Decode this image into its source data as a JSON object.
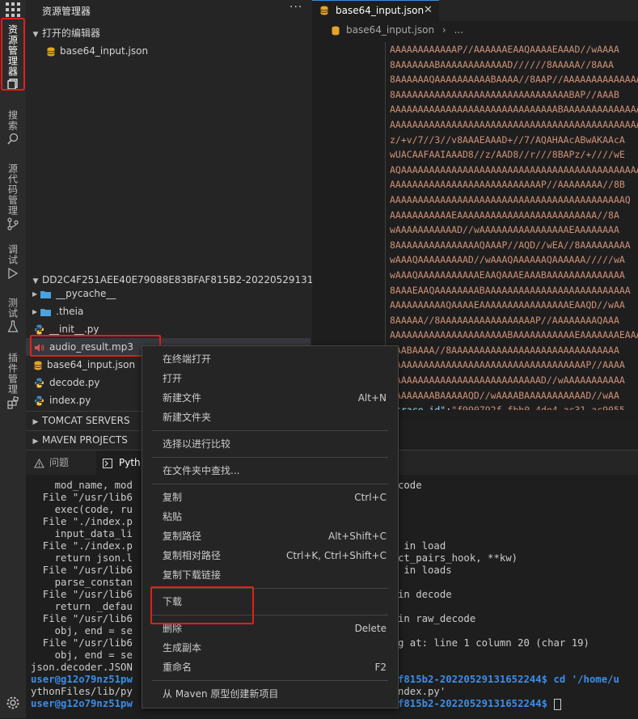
{
  "activity_bar": {
    "items": [
      {
        "label": "资源管理器",
        "icon": "files-icon"
      },
      {
        "label": "搜索",
        "icon": "search-icon"
      },
      {
        "label": "源代码管理",
        "icon": "source-control-icon"
      },
      {
        "label": "调试",
        "icon": "debug-icon"
      },
      {
        "label": "测试",
        "icon": "flask-icon"
      },
      {
        "label": "插件管理",
        "icon": "extensions-icon"
      }
    ]
  },
  "sidebar": {
    "title": "资源管理器",
    "more": "···",
    "open_editors": {
      "header": "打开的编辑器",
      "files": [
        "base64_input.json"
      ]
    },
    "workspace": {
      "header": "DD2C4F251AEE40E79088E83BFAF815B2-20220529131652",
      "folders": [
        "__pycache__",
        ".theia"
      ],
      "files": [
        "__init__.py",
        "audio_result.mp3",
        "base64_input.json",
        "decode.py",
        "index.py"
      ]
    },
    "tomcat_header": "TOMCAT SERVERS",
    "maven_header": "MAVEN PROJECTS"
  },
  "editor": {
    "tab_label": "base64_input.json",
    "close_glyph": "✕",
    "breadcrumb": {
      "file": "base64_input.json",
      "sep": "›",
      "rest": "..."
    },
    "lines": [
      "AAAAAAAAAAAAP//AAAAAAEAAQAAAAEAAAD//wAAAA",
      "8AAAAAAABAAAAAAAAAAAAD//////8AAAAA//8AAA",
      "8AAAAAAQAAAAAAAAAABAAAA//8AAP//AAAAAAAAAAAAAA",
      "8AAAAAAAAAAAAAAAAAAAAAAAAAAAAAAABAP//AAAB",
      "AAAAAAAAAAAAAAAAAAAAAAAAAAAAAABAAAAAAAAAAAAAA",
      "AAAAAAAAAAAAAAAAAAAAAAAAAAAAAAAAAAAAAAAAAAAAA",
      "z/+v/7//3//v8AAAEAAAD+//7/AQAHAAcABwAKAAcA",
      "wUACAAFAAIAAAD8//z/AAD8//r///8BAPz/+////wE",
      "AQAAAAAAAAAAAAAAAAAAAAAAAAAAAAAAAAAAAAAAAAAAAA",
      "AAAAAAAAAAAAAAAAAAAAAAAAAAAP//AAAAAAAA//8B",
      "AAAAAAAAAAAAAAAAAAAAAAAAAAAAAAAAAAAAAAAAAAQ",
      "AAAAAAAAAAAEAAAAAAAAAAAAAAAAAAAAAAAAA//8A",
      "wAAAAAAAAAAAD//wAAAAAAAAAAAAAAAAEAAAAAAAA",
      "8AAAAAAAAAAAAAAAQAAAP//AQD//wEA//8AAAAAAAAA",
      "wAAAQAAAAAAAAAD//wAAAQAAAAAAQAAAAAA/////wA",
      "wAAAQAAAAAAAAAAAEAAQAAAEAAABAAAAAAAAAAAAAA",
      "8AAAEAAQAAAAAAAABAAAAAAAAAAAAAAAAAAAAAAAAAA",
      "AAAAAAAAAAQAAAAEAAAAAAAAAAAAAAAAEAAQD//wAA",
      "8AAAAA//8AAAAAAAAAAAAAAAAAP//AAAAAAAAQAAA",
      "AAAAAAAAAAAAAAAAAAAAABAAAAAAAAAAAEAAAAAAAEAAA",
      "AAABAAAA//8AAAAAAAAAAAAAAAAAAAAAAAAAAAAAA",
      "AAAAAAAAAAAAAAAAAAAAAAAAAAAAAAAAAAAP//AAAA",
      "AAAAAAAAAAAAAAAAAAAAAAAAAAAD//wAAAAAAAAAAA",
      "AAAAAAAABAAAAAQD//wAAAABAAAAAAAAAAAD//wAA"
    ],
    "last_line": {
      "key": "\"trace_id\"",
      "colon": ":",
      "value": "\"f990792f-fbb0-4de4-ac31-ac9055"
    }
  },
  "panel": {
    "tabs": [
      {
        "label": "问题",
        "icon": "warning-icon"
      },
      {
        "label": "Pyth",
        "icon": "terminal-icon"
      }
    ],
    "terminal": {
      "left": [
        "    mod_name, mod",
        "  File \"/usr/lib6",
        "    exec(code, ru",
        "  File \"./index.p",
        "    input_data_li",
        "  File \"./index.p",
        "    return json.l",
        "  File \"/usr/lib6",
        "    parse_constan",
        "  File \"/usr/lib6",
        "    return _defau",
        "  File \"/usr/lib6",
        "    obj, end = se",
        "  File \"/usr/lib6",
        "    obj, end = se",
        "json.decoder.JSON"
      ],
      "right": [
        "code",
        "",
        "",
        "",
        "",
        " in load",
        "ct_pairs_hook, **kw)",
        " in loads",
        "",
        "in decode",
        "",
        "in raw_decode",
        "",
        "g at: line 1 column 20 (char 19)"
      ],
      "prompt_user": "user@g12o79nz51pw",
      "prompt_tail_1": "f815b2-20220529131652244$ cd '/home/u",
      "line_python": "ythonFiles/lib/py",
      "line_python_tail": "ndex.py'",
      "prompt_tail_2": "f815b2-20220529131652244$ "
    }
  },
  "context_menu": {
    "groups": [
      [
        {
          "label": "在终端打开",
          "shortcut": ""
        },
        {
          "label": "打开",
          "shortcut": ""
        },
        {
          "label": "新建文件",
          "shortcut": "Alt+N"
        },
        {
          "label": "新建文件夹",
          "shortcut": ""
        }
      ],
      [
        {
          "label": "选择以进行比较",
          "shortcut": ""
        }
      ],
      [
        {
          "label": "在文件夹中查找...",
          "shortcut": ""
        }
      ],
      [
        {
          "label": "复制",
          "shortcut": "Ctrl+C"
        },
        {
          "label": "粘贴",
          "shortcut": ""
        },
        {
          "label": "复制路径",
          "shortcut": "Alt+Shift+C"
        },
        {
          "label": "复制相对路径",
          "shortcut": "Ctrl+K, Ctrl+Shift+C"
        },
        {
          "label": "复制下载链接",
          "shortcut": ""
        }
      ],
      [
        {
          "label": "下载",
          "shortcut": ""
        }
      ],
      [
        {
          "label": "删除",
          "shortcut": "Delete"
        },
        {
          "label": "生成副本",
          "shortcut": ""
        },
        {
          "label": "重命名",
          "shortcut": "F2"
        }
      ],
      [
        {
          "label": "从 Maven 原型创建新项目",
          "shortcut": ""
        }
      ]
    ]
  },
  "colors": {
    "highlight_box": "#e0201b",
    "json_string": "#ce9178",
    "json_key": "#9cdcfe",
    "prompt": "#3b8eea"
  }
}
